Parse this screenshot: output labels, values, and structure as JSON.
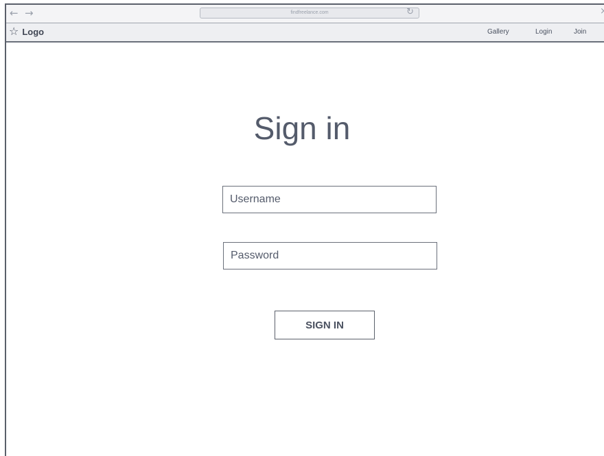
{
  "browser": {
    "url": "findfreelance.com",
    "back_icon": "arrow-left-icon",
    "forward_icon": "arrow-right-icon",
    "reload_icon": "reload-icon",
    "close_icon": "close-icon"
  },
  "navbar": {
    "logo_icon": "star-icon",
    "logo_label": "Logo",
    "links": [
      {
        "label": "Gallery"
      },
      {
        "label": "Login"
      },
      {
        "label": "Join"
      }
    ]
  },
  "main": {
    "title": "Sign in",
    "username": {
      "placeholder": "Username",
      "value": ""
    },
    "password": {
      "placeholder": "Password",
      "value": ""
    },
    "submit_label": "SIGN IN"
  },
  "colors": {
    "text": "#4a5160",
    "border": "#5a5f6a",
    "navbar_bg": "#eeeff2"
  }
}
